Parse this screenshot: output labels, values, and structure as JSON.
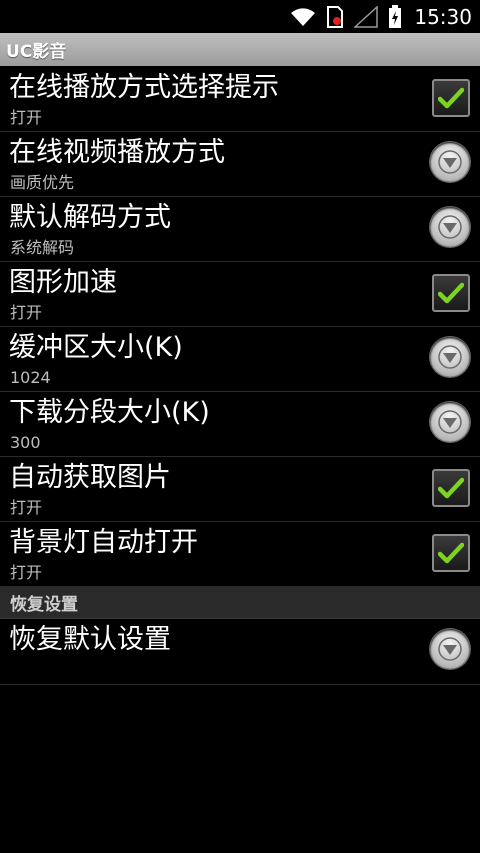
{
  "status_bar": {
    "time": "15:30",
    "icons": [
      "wifi-icon",
      "sim-card-icon",
      "signal-icon",
      "battery-charging-icon"
    ]
  },
  "title_bar": {
    "title": "UC影音"
  },
  "settings": [
    {
      "title": "在线播放方式选择提示",
      "summary": "打开",
      "control": "checkbox",
      "checked": true
    },
    {
      "title": "在线视频播放方式",
      "summary": "画质优先",
      "control": "dropdown"
    },
    {
      "title": "默认解码方式",
      "summary": "系统解码",
      "control": "dropdown"
    },
    {
      "title": "图形加速",
      "summary": "打开",
      "control": "checkbox",
      "checked": true
    },
    {
      "title": "缓冲区大小(K)",
      "summary": "1024",
      "control": "dropdown"
    },
    {
      "title": "下载分段大小(K)",
      "summary": "300",
      "control": "dropdown"
    },
    {
      "title": "自动获取图片",
      "summary": "打开",
      "control": "checkbox",
      "checked": true
    },
    {
      "title": "背景灯自动打开",
      "summary": "打开",
      "control": "checkbox",
      "checked": true
    }
  ],
  "restore_section": {
    "header": "恢复设置",
    "item": {
      "title": "恢复默认设置",
      "control": "dropdown"
    }
  },
  "colors": {
    "check_green": "#7ed321",
    "title_bar": "#a8a8a8"
  }
}
